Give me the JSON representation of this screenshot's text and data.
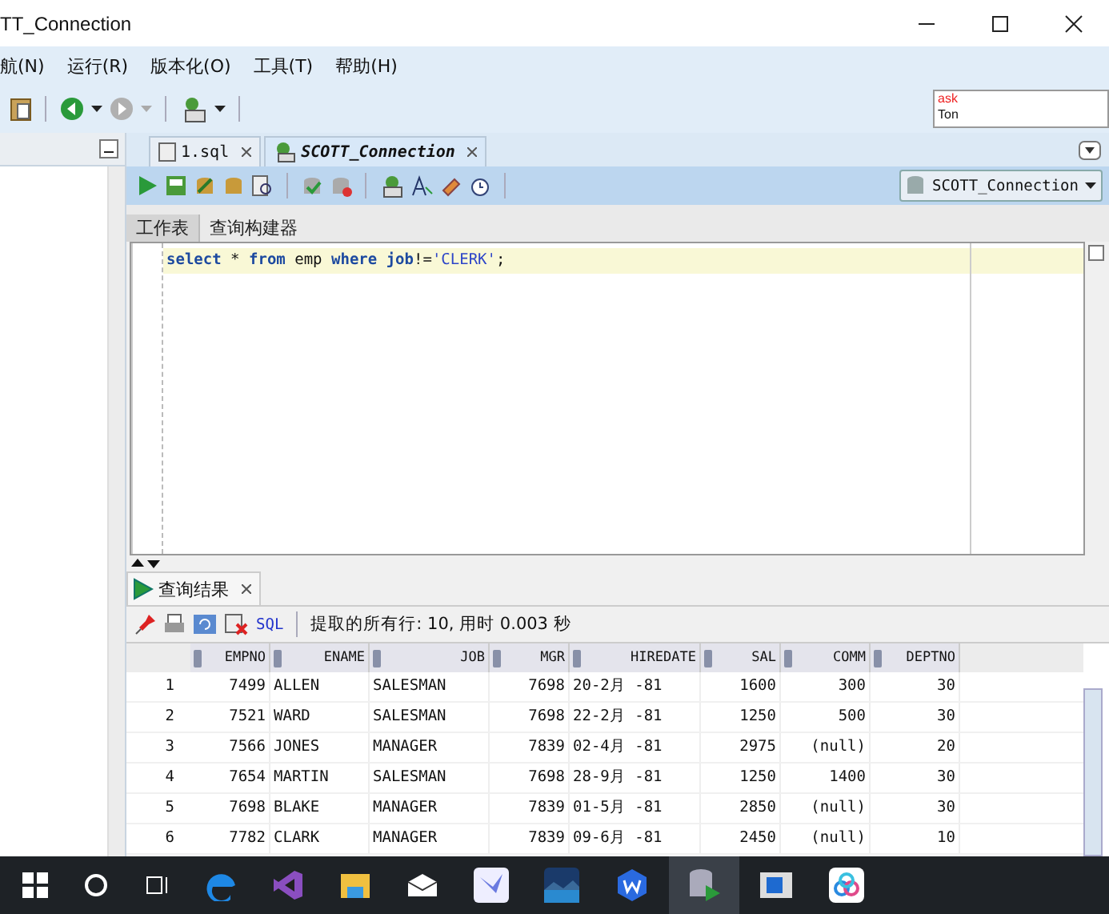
{
  "window": {
    "title": "TT_Connection"
  },
  "menu": [
    {
      "label": "航(N)"
    },
    {
      "label": "运行(R)"
    },
    {
      "label": "版本化(O)"
    },
    {
      "label": "工具(T)"
    },
    {
      "label": "帮助(H)"
    }
  ],
  "memory_panel": {
    "line_1": "ask",
    "line_2": "Ton"
  },
  "tabs": [
    {
      "label": "1.sql",
      "selected": false
    },
    {
      "label": "SCOTT_Connection",
      "selected": true
    }
  ],
  "connection_select": {
    "value": "SCOTT_Connection"
  },
  "editor_tabs": [
    {
      "label": "工作表",
      "selected": true
    },
    {
      "label": "查询构建器",
      "selected": false
    }
  ],
  "editor": {
    "tokens": [
      {
        "text": "select",
        "kind": "keyword"
      },
      {
        "text": " * ",
        "kind": "plain"
      },
      {
        "text": "from",
        "kind": "keyword"
      },
      {
        "text": " emp ",
        "kind": "plain"
      },
      {
        "text": "where",
        "kind": "keyword"
      },
      {
        "text": " job",
        "kind": "keyword"
      },
      {
        "text": "!=",
        "kind": "plain"
      },
      {
        "text": "'CLERK'",
        "kind": "string"
      },
      {
        "text": ";",
        "kind": "plain"
      }
    ]
  },
  "results": {
    "tab": "查询结果",
    "sql_link": "SQL",
    "status": "提取的所有行: 10, 用时 0.003 秒",
    "columns": [
      {
        "label": "EMPNO"
      },
      {
        "label": "ENAME"
      },
      {
        "label": "JOB"
      },
      {
        "label": "MGR"
      },
      {
        "label": "HIREDATE"
      },
      {
        "label": "SAL"
      },
      {
        "label": "COMM"
      },
      {
        "label": "DEPTNO"
      }
    ],
    "rows": [
      {
        "number": "1",
        "cells": [
          "7499",
          "ALLEN",
          "SALESMAN",
          "7698",
          "20-2月 -81",
          "1600",
          "300",
          "30"
        ]
      },
      {
        "number": "2",
        "cells": [
          "7521",
          "WARD",
          "SALESMAN",
          "7698",
          "22-2月 -81",
          "1250",
          "500",
          "30"
        ]
      },
      {
        "number": "3",
        "cells": [
          "7566",
          "JONES",
          "MANAGER",
          "7839",
          "02-4月 -81",
          "2975",
          "(null)",
          "20"
        ]
      },
      {
        "number": "4",
        "cells": [
          "7654",
          "MARTIN",
          "SALESMAN",
          "7698",
          "28-9月 -81",
          "1250",
          "1400",
          "30"
        ]
      },
      {
        "number": "5",
        "cells": [
          "7698",
          "BLAKE",
          "MANAGER",
          "7839",
          "01-5月 -81",
          "2850",
          "(null)",
          "30"
        ]
      },
      {
        "number": "6",
        "cells": [
          "7782",
          "CLARK",
          "MANAGER",
          "7839",
          "09-6月 -81",
          "2450",
          "(null)",
          "10"
        ]
      }
    ]
  }
}
